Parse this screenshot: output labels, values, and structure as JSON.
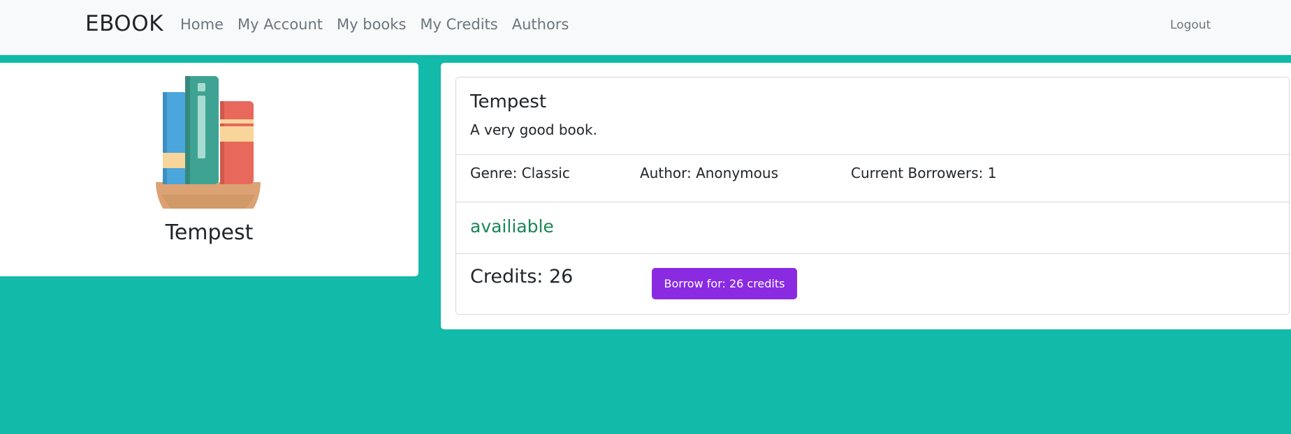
{
  "navbar": {
    "brand": "EBOOK",
    "links": [
      "Home",
      "My Account",
      "My books",
      "My Credits",
      "Authors"
    ],
    "logout": "Logout"
  },
  "book": {
    "title": "Tempest",
    "description": "A very good book.",
    "genre": "Genre: Classic",
    "author": "Author: Anonymous",
    "borrowers": "Current Borrowers: 1",
    "status": "availiable",
    "credits": "Credits: 26",
    "borrow_label": "Borrow for: 26 credits"
  },
  "icons": {
    "book_illustration": "books-on-shelf-icon"
  },
  "colors": {
    "background": "#11baa9",
    "status_available": "#198754",
    "borrow_button": "#8a2be2"
  }
}
